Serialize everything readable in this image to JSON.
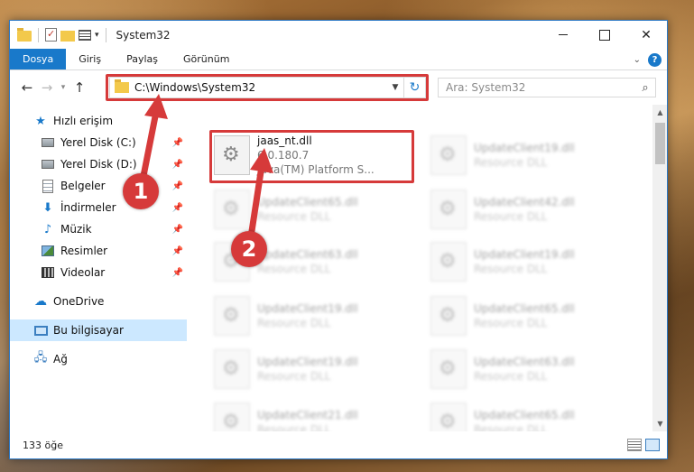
{
  "window": {
    "title": "System32"
  },
  "ribbon": {
    "tabs": [
      "Dosya",
      "Giriş",
      "Paylaş",
      "Görünüm"
    ]
  },
  "nav": {
    "address": "C:\\Windows\\System32",
    "search_placeholder": "Ara: System32"
  },
  "sidebar": {
    "items": [
      {
        "label": "Hızlı erişim",
        "icon": "star-icon"
      },
      {
        "label": "Yerel Disk (C:)",
        "icon": "drive-icon"
      },
      {
        "label": "Yerel Disk (D:)",
        "icon": "drive-icon"
      },
      {
        "label": "Belgeler",
        "icon": "document-icon"
      },
      {
        "label": "İndirmeler",
        "icon": "download-icon"
      },
      {
        "label": "Müzik",
        "icon": "music-icon"
      },
      {
        "label": "Resimler",
        "icon": "pictures-icon"
      },
      {
        "label": "Videolar",
        "icon": "videos-icon"
      },
      {
        "label": "OneDrive",
        "icon": "cloud-icon"
      },
      {
        "label": "Bu bilgisayar",
        "icon": "computer-icon"
      },
      {
        "label": "Ağ",
        "icon": "network-icon"
      }
    ]
  },
  "files": {
    "highlighted": {
      "name": "jaas_nt.dll",
      "version": "6.0.180.7",
      "description": "Java(TM) Platform S..."
    },
    "left_column": [
      {
        "name": "UpdateClient65.dll",
        "type": "Resource DLL"
      },
      {
        "name": "UpdateClient63.dll",
        "type": "Resource DLL"
      },
      {
        "name": "UpdateClient19.dll",
        "type": "Resource DLL"
      },
      {
        "name": "UpdateClient19.dll",
        "type": "Resource DLL"
      },
      {
        "name": "UpdateClient21.dll",
        "type": "Resource DLL"
      }
    ],
    "right_column": [
      {
        "name": "UpdateClient19.dll",
        "type": "Resource DLL"
      },
      {
        "name": "UpdateClient42.dll",
        "type": "Resource DLL"
      },
      {
        "name": "UpdateClient19.dll",
        "type": "Resource DLL"
      },
      {
        "name": "UpdateClient65.dll",
        "type": "Resource DLL"
      },
      {
        "name": "UpdateClient63.dll",
        "type": "Resource DLL"
      },
      {
        "name": "UpdateClient65.dll",
        "type": "Resource DLL"
      }
    ]
  },
  "status": {
    "item_count": "133 öğe"
  },
  "annotations": {
    "marker1": "1",
    "marker2": "2",
    "color": "#d63a3a"
  }
}
